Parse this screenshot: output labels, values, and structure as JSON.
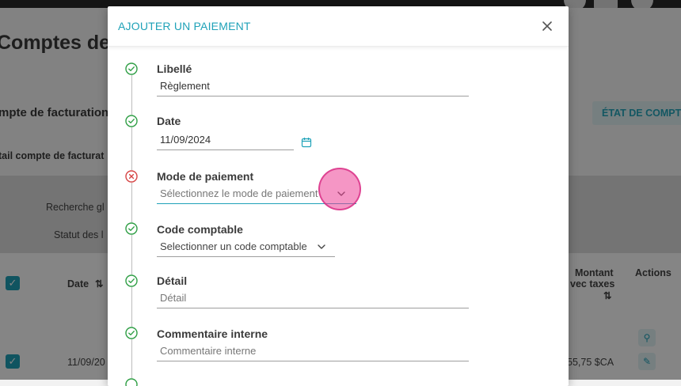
{
  "background": {
    "page_title": "Comptes de f",
    "card_title": "mpte de facturation",
    "subsection_title": "tail compte de facturat",
    "etat_button_label": "ÉTAT DE COMPTE",
    "filters": {
      "search_label": "Recherche gl",
      "status_label": "Statut des l"
    },
    "table": {
      "col_date": "Date",
      "col_amount_line1": "Montant",
      "col_amount_line2": "vec taxes",
      "col_actions": "Actions",
      "sort_glyph": "⇅",
      "row1_date": "11/09/20",
      "row1_amount": "55,75 $CA"
    }
  },
  "modal": {
    "title": "AJOUTER UN PAIEMENT",
    "close_icon": "close-icon",
    "fields": [
      {
        "label": "Libellé",
        "value": "Règlement",
        "placeholder": "",
        "status": "valid"
      },
      {
        "label": "Date",
        "value": "11/09/2024",
        "placeholder": "",
        "status": "valid"
      },
      {
        "label": "Mode de paiement",
        "value": "",
        "placeholder": "Sélectionnez le mode de paiement",
        "status": "error"
      },
      {
        "label": "Code comptable",
        "value": "",
        "placeholder": "Selectionner un code comptable",
        "status": "valid"
      },
      {
        "label": "Détail",
        "value": "",
        "placeholder": "Détail",
        "status": "valid"
      },
      {
        "label": "Commentaire interne",
        "value": "",
        "placeholder": "Commentaire interne",
        "status": "valid"
      }
    ]
  },
  "colors": {
    "accent": "#1fa2b8",
    "valid": "#2e9e44",
    "error": "#d64545",
    "touch_indicator": "#ec4096"
  }
}
